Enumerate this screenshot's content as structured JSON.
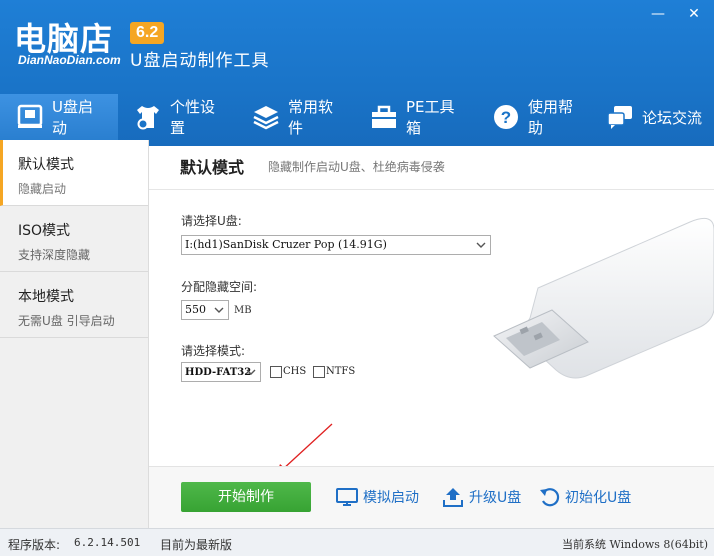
{
  "app": {
    "logo_text": "电脑店",
    "logo_sub": "DianNaoDian.com",
    "version_badge": "6.2",
    "subtitle": "U盘启动制作工具",
    "min_glyph": "—",
    "close_glyph": "✕"
  },
  "nav": [
    {
      "label": "U盘启动",
      "icon": "usb-drive-icon"
    },
    {
      "label": "个性设置",
      "icon": "shirt-gear-icon"
    },
    {
      "label": "常用软件",
      "icon": "layers-icon"
    },
    {
      "label": "PE工具箱",
      "icon": "toolbox-icon"
    },
    {
      "label": "使用帮助",
      "icon": "help-icon"
    },
    {
      "label": "论坛交流",
      "icon": "chat-icon"
    }
  ],
  "sidebar": [
    {
      "title": "默认模式",
      "desc": "隐藏启动"
    },
    {
      "title": "ISO模式",
      "desc": "支持深度隐藏"
    },
    {
      "title": "本地模式",
      "desc": "无需U盘 引导启动"
    }
  ],
  "main": {
    "title": "默认模式",
    "subtitle": "隐藏制作启动U盘、杜绝病毒侵袭",
    "select_disk_label": "请选择U盘:",
    "disk_value": "I:(hd1)SanDisk Cruzer Pop (14.91G)",
    "hidden_space_label": "分配隐藏空间:",
    "hidden_space_value": "550",
    "hidden_space_unit": "MB",
    "mode_label": "请选择模式:",
    "mode_value": "HDD-FAT32",
    "chs_label": "CHS",
    "ntfs_label": "NTFS"
  },
  "actions": {
    "start": "开始制作",
    "simulate": "模拟启动",
    "upgrade": "升级U盘",
    "initialize": "初始化U盘"
  },
  "status": {
    "version_label": "程序版本:",
    "version_value": "6.2.14.501",
    "latest": "目前为最新版",
    "system_label": "当前系统",
    "system_value": "Windows 8(64bit)"
  },
  "colors": {
    "header_blue": "#1a74c8",
    "accent_orange": "#f5a623",
    "start_green": "#3eaa3a",
    "link_blue": "#1f6fc6"
  }
}
